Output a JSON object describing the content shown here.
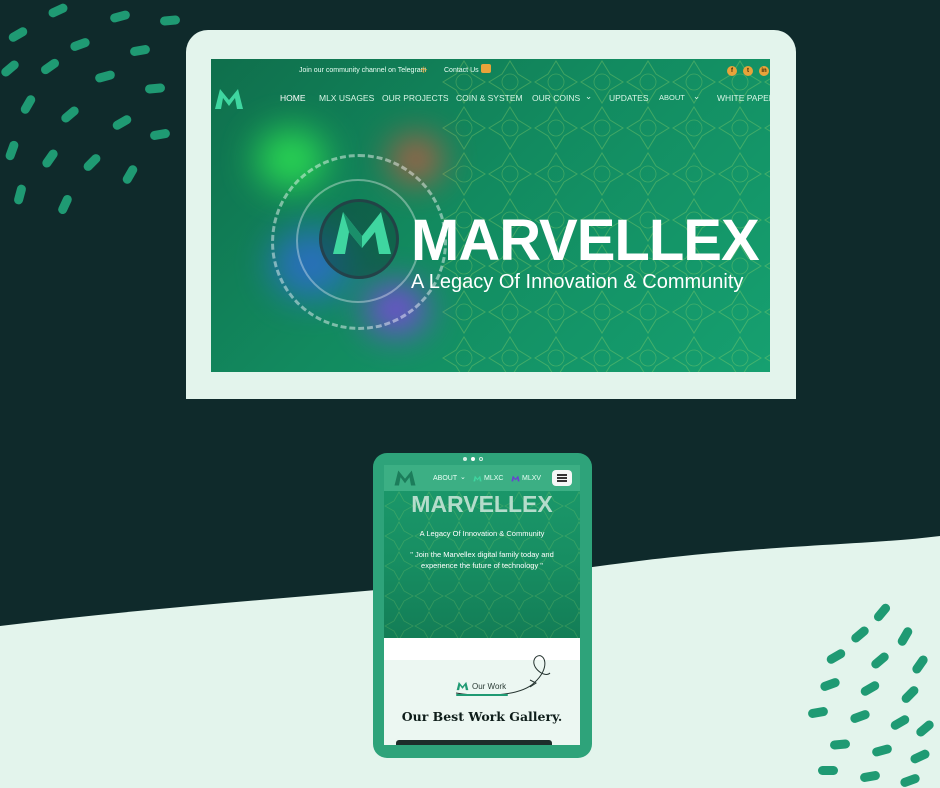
{
  "colors": {
    "background_dark": "#0f2a2b",
    "background_light": "#e3f4ec",
    "accent_green": "#1f9a73",
    "hero_green": "#128a5f",
    "social_orange": "#e8a33a"
  },
  "desktop": {
    "topbar": {
      "telegram_text": "Join our community channel on Telegram",
      "telegram_icon": "telegram-icon",
      "contact_text": "Contact Us",
      "contact_icon": "chat-icon",
      "social": [
        {
          "icon": "facebook-icon",
          "glyph": "f"
        },
        {
          "icon": "twitter-icon",
          "glyph": "t"
        },
        {
          "icon": "linkedin-icon",
          "glyph": "in"
        }
      ]
    },
    "nav": {
      "items": [
        "HOME",
        "MLX USAGES",
        "OUR PROJECTS",
        "COIN & SYSTEM",
        "OUR COINS",
        "UPDATES",
        "ABOUT",
        "WHITE PAPER"
      ],
      "active": "HOME"
    },
    "hero": {
      "title": "MARVELLEX",
      "subtitle": "A Legacy Of Innovation & Community"
    }
  },
  "tablet": {
    "nav": {
      "about": "ABOUT",
      "coin1": "MLXC",
      "coin2": "MLXV",
      "menu_icon": "hamburger-menu-icon"
    },
    "hero": {
      "title": "MARVELLEX",
      "subtitle": "A Legacy Of Innovation & Community",
      "quote": "\" Join the Marvellex digital family today and experience the future of technology \""
    },
    "section": {
      "label": "Our Work",
      "title": "Our Best Work Gallery."
    }
  }
}
